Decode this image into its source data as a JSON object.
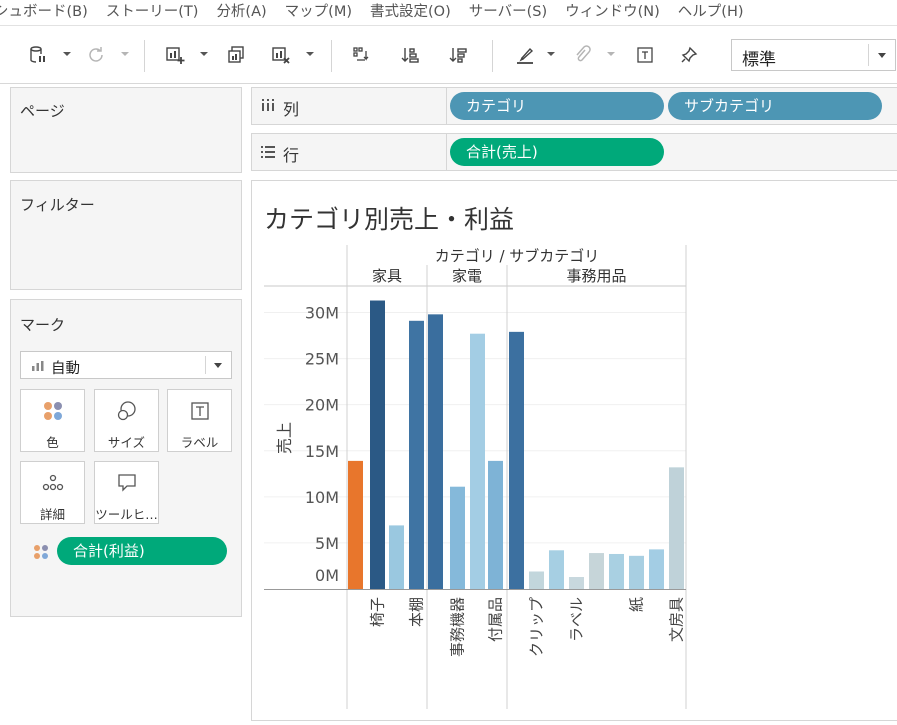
{
  "menu": [
    "シュボード(B)",
    "ストーリー(T)",
    "分析(A)",
    "マップ(M)",
    "書式設定(O)",
    "サーバー(S)",
    "ウィンドウ(N)",
    "ヘルプ(H)"
  ],
  "toolbar": {
    "fit_value": "標準"
  },
  "panels": {
    "pages_title": "ページ",
    "filters_title": "フィルター",
    "marks_title": "マーク"
  },
  "marks": {
    "type": "自動",
    "cards": [
      {
        "label": "色",
        "icon": "color-icon"
      },
      {
        "label": "サイズ",
        "icon": "size-icon"
      },
      {
        "label": "ラベル",
        "icon": "label-icon"
      },
      {
        "label": "詳細",
        "icon": "detail-icon"
      },
      {
        "label": "ツールヒ…",
        "icon": "tooltip-icon"
      }
    ],
    "color_field": "合計(利益)"
  },
  "shelves": {
    "columns_label": "列",
    "rows_label": "行",
    "columns_pills": [
      "カテゴリ",
      "サブカテゴリ"
    ],
    "rows_pills": [
      "合計(売上)"
    ]
  },
  "colors": {
    "pill_blue": "#4d96b4",
    "pill_green": "#00a97a",
    "orange": "#e8762c",
    "dark_blue": "#2a5783"
  },
  "chart_data": {
    "type": "bar",
    "title": "カテゴリ別売上・利益",
    "header": "カテゴリ / サブカテゴリ",
    "ylabel": "売上",
    "ylim": [
      0,
      32000000
    ],
    "yticks": [
      0,
      5000000,
      10000000,
      15000000,
      20000000,
      25000000,
      30000000
    ],
    "ytick_labels": [
      "0M",
      "5M",
      "10M",
      "15M",
      "20M",
      "25M",
      "30M"
    ],
    "groups": [
      {
        "name": "家具",
        "subcategories": [
          {
            "name": "",
            "value": 13900000,
            "color": "#e8762c"
          },
          {
            "name": "椅子",
            "value": 31300000,
            "color": "#2b5985"
          },
          {
            "name": "",
            "value": 6900000,
            "color": "#9ac8e0"
          },
          {
            "name": "本棚",
            "value": 29100000,
            "color": "#3f74a3"
          }
        ]
      },
      {
        "name": "家電",
        "subcategories": [
          {
            "name": "",
            "value": 29800000,
            "color": "#3a6e9e"
          },
          {
            "name": "事務機器",
            "value": 11100000,
            "color": "#85b9da"
          },
          {
            "name": "",
            "value": 27700000,
            "color": "#a3cde4"
          },
          {
            "name": "付属品",
            "value": 13900000,
            "color": "#7eb3d6"
          }
        ]
      },
      {
        "name": "事務用品",
        "subcategories": [
          {
            "name": "",
            "value": 27900000,
            "color": "#3c70a0"
          },
          {
            "name": "クリップ",
            "value": 1900000,
            "color": "#c2d6dc"
          },
          {
            "name": "",
            "value": 4200000,
            "color": "#a6cfe3"
          },
          {
            "name": "ラベル",
            "value": 1300000,
            "color": "#c8d8de"
          },
          {
            "name": "",
            "value": 3900000,
            "color": "#c6d5d9"
          },
          {
            "name": "",
            "value": 3800000,
            "color": "#a9d0e2"
          },
          {
            "name": "紙",
            "value": 3600000,
            "color": "#a8cfe2"
          },
          {
            "name": "",
            "value": 4300000,
            "color": "#a3cde4"
          },
          {
            "name": "文房具",
            "value": 13200000,
            "color": "#bfd2d9"
          }
        ]
      }
    ]
  }
}
